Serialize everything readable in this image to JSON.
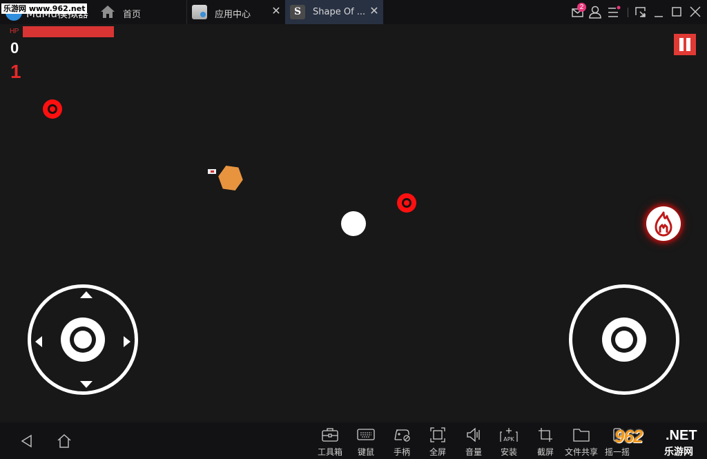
{
  "titlebar": {
    "app_name": "MuMu模拟器",
    "watermark": "乐游网 www.962.net",
    "home_label": "首页",
    "tabs": [
      {
        "label": "应用中心",
        "icon": "app-center-icon",
        "active": false
      },
      {
        "label": "Shape Of ...",
        "icon": "game-s-icon",
        "icon_glyph": "S",
        "active": true
      }
    ],
    "mail_badge_count": "2",
    "controls": [
      "mail-icon",
      "user-icon",
      "menu-icon",
      "restore-window-icon",
      "minimize-icon",
      "maximize-icon",
      "close-icon"
    ]
  },
  "game": {
    "hp_label": "HP",
    "hp_fraction": 1.0,
    "score": "0",
    "level": "1",
    "colors": {
      "accent_red": "#e03a35",
      "hp_red": "#d83434",
      "enemy_orange": "#e8943f",
      "player": "#ffffff",
      "target_red": "#ff1010"
    }
  },
  "bottombar": {
    "nav": [
      "back-icon",
      "home-icon"
    ],
    "tools": [
      {
        "label": "工具箱",
        "icon": "toolbox-icon"
      },
      {
        "label": "键鼠",
        "icon": "keyboard-icon"
      },
      {
        "label": "手柄",
        "icon": "gamepad-icon"
      },
      {
        "label": "全屏",
        "icon": "fullscreen-icon"
      },
      {
        "label": "音量",
        "icon": "volume-icon"
      },
      {
        "label": "安装",
        "icon": "install-apk-icon",
        "icon_text": "APK"
      },
      {
        "label": "截屏",
        "icon": "crop-screenshot-icon"
      },
      {
        "label": "文件共享",
        "icon": "folder-icon"
      },
      {
        "label": "摇一摇",
        "icon": "shake-icon"
      }
    ],
    "watermark": {
      "number": "962",
      "suffix": ".NET",
      "cn": "乐游网"
    }
  }
}
